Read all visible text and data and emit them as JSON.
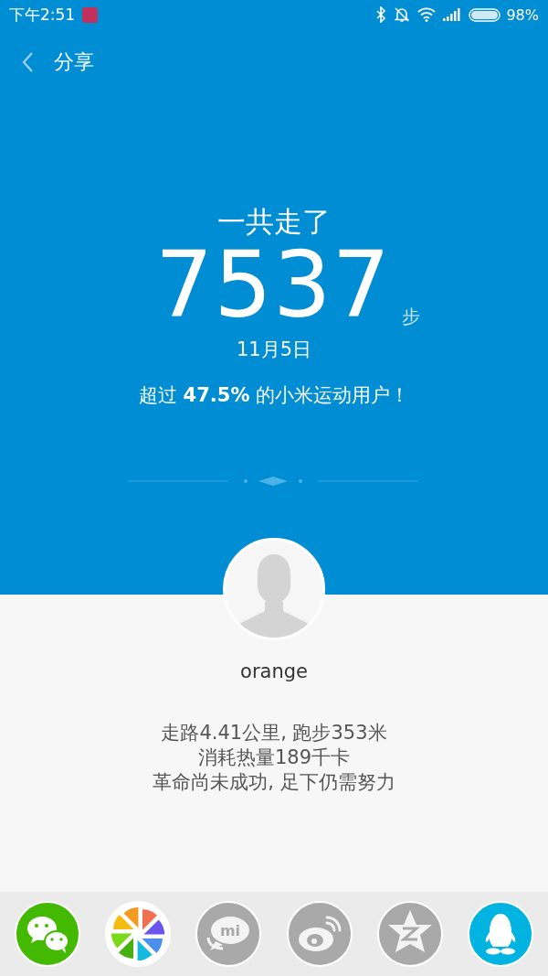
{
  "status_bar": {
    "time": "下午2:51",
    "battery": "98%"
  },
  "header": {
    "title": "分享"
  },
  "summary": {
    "heading": "一共走了",
    "steps": "7537",
    "unit": "步",
    "date": "11月5日",
    "rank": "超过 **47.5%** 的小米运动用户！"
  },
  "profile": {
    "name": "orange"
  },
  "stats": [
    "走路4.41公里, 跑步353米",
    "消耗热量189千卡",
    "革命尚未成功, 足下仍需努力"
  ],
  "share_targets": [
    {
      "kind": "wechat"
    },
    {
      "kind": "moments"
    },
    {
      "kind": "mi",
      "label": "mi"
    },
    {
      "kind": "weibo"
    },
    {
      "kind": "qzone"
    },
    {
      "kind": "qq"
    }
  ]
}
